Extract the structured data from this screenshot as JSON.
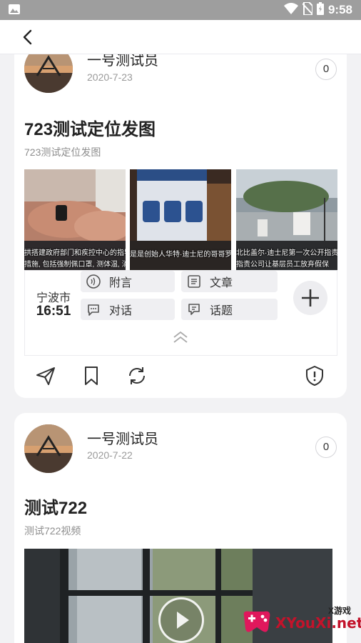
{
  "status_bar": {
    "time": "9:58"
  },
  "posts": [
    {
      "username": "一号测试员",
      "date": "2020-7-23",
      "count": "0",
      "title": "723测试定位发图",
      "subtitle": "723测试定位发图",
      "image_captions": [
        "拱搭建政府部门和疾控中心的指导,",
        "措施, 包括强制佩口罩, 测体温, 消",
        "是是创始人华特·迪士尼的哥哥罗",
        "北比盖尔·迪士尼第一次公开指责公",
        "指责公司让基层员工放弃假保"
      ],
      "location": {
        "city": "宁波市",
        "time": "16:51"
      },
      "options": [
        "附言",
        "文章",
        "对话",
        "话题"
      ]
    },
    {
      "username": "一号测试员",
      "date": "2020-7-22",
      "count": "0",
      "title": "测试722",
      "subtitle": "测试722视频"
    }
  ],
  "watermark": {
    "small": "X游戏",
    "main": "XYouXi.net"
  },
  "icons": [
    "image-icon",
    "wifi-icon",
    "no-sim-icon",
    "battery-icon",
    "back-arrow-icon",
    "message-icon",
    "article-icon",
    "chat-icon",
    "topic-icon",
    "plus-icon",
    "chevron-up-icon",
    "send-icon",
    "bookmark-icon",
    "repost-icon",
    "report-icon",
    "play-icon"
  ]
}
